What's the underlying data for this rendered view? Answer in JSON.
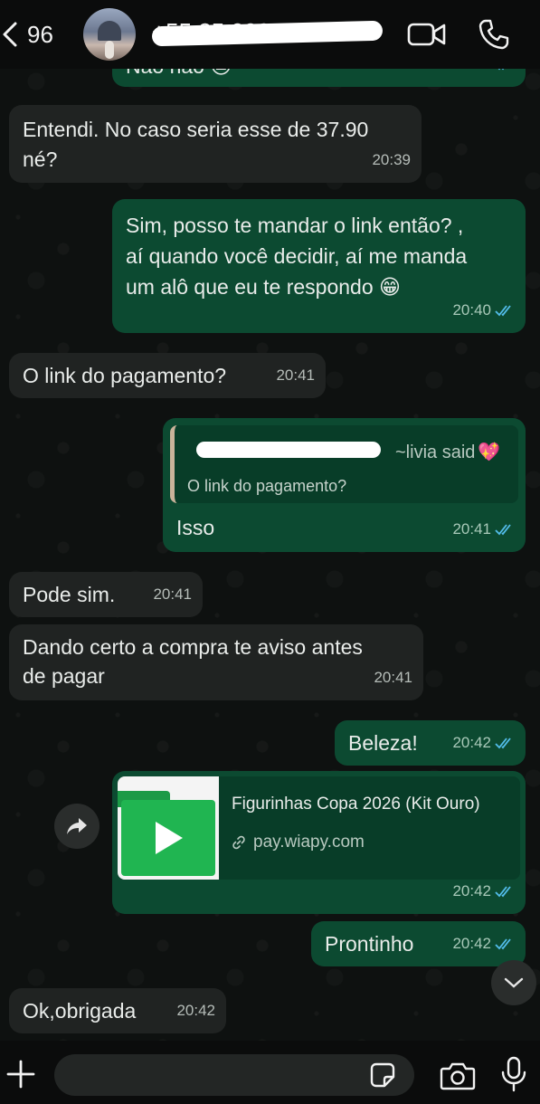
{
  "header": {
    "back_count": "96",
    "contact_name": "+55 35 9934 8075"
  },
  "messages": {
    "m0": {
      "text": "Não não 😔",
      "time": "20:39"
    },
    "m1": {
      "line1": "Entendi. No caso seria esse de 37.90",
      "line2": "né?",
      "time": "20:39"
    },
    "m2": {
      "line1": "Sim, posso te mandar o link então? ,",
      "line2": "aí quando você decidir, aí me manda",
      "line3": "um alô que eu te respondo 😁",
      "time": "20:40"
    },
    "m3": {
      "text": "O link do pagamento?",
      "time": "20:41"
    },
    "m4": {
      "quote_author": "~livia said",
      "quote_emoji": "💖",
      "quote_text": "O link do pagamento?",
      "text": "Isso",
      "time": "20:41"
    },
    "m5": {
      "text": "Pode sim.",
      "time": "20:41"
    },
    "m6": {
      "line1": "Dando certo a compra te aviso antes",
      "line2": "de pagar",
      "time": "20:41"
    },
    "m7": {
      "text": "Beleza!",
      "time": "20:42"
    },
    "m8": {
      "link_title": "Figurinhas Copa 2026 (Kit Ouro)",
      "link_url": "pay.wiapy.com",
      "time": "20:42"
    },
    "m9": {
      "text": "Prontinho",
      "time": "20:42"
    },
    "m10": {
      "text": "Ok,obrigada",
      "time": "20:42"
    }
  },
  "composer": {
    "placeholder": ""
  },
  "colors": {
    "incoming_bubble": "#202322",
    "outgoing_bubble": "#0c4a31",
    "read_tick": "#53bdeb"
  }
}
